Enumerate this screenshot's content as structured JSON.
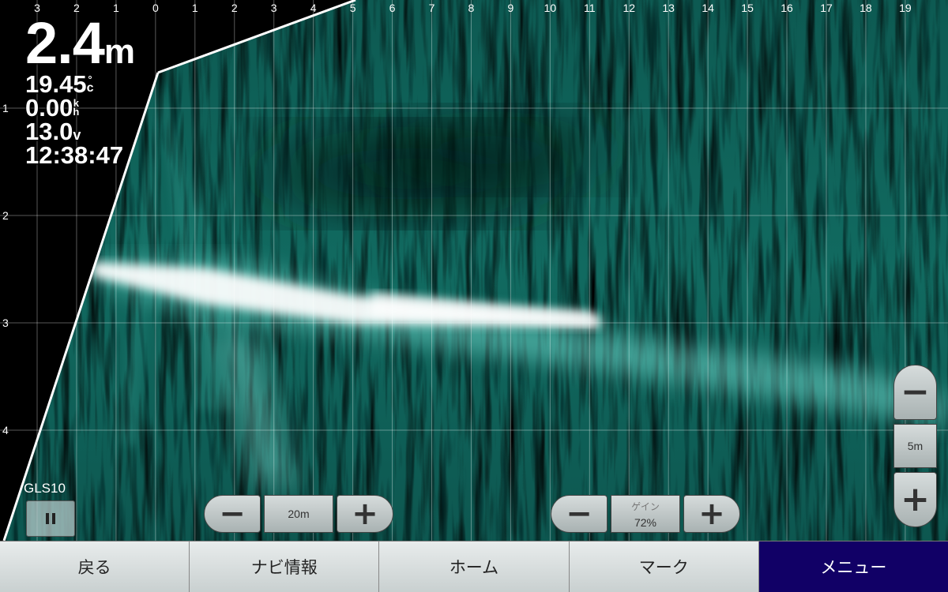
{
  "readouts": {
    "depth_value": "2.4",
    "depth_unit": "m",
    "water_temp": "19.45",
    "water_temp_unit_top": "°",
    "water_temp_unit_bottom": "c",
    "speed": "0.00",
    "speed_unit_top": "k",
    "speed_unit_bottom": "h",
    "voltage": "13.0",
    "voltage_unit": "v",
    "time": "12:38:47"
  },
  "scale": {
    "x_ticks": [
      "3",
      "2",
      "1",
      "0",
      "1",
      "2",
      "3",
      "4",
      "5",
      "6",
      "7",
      "8",
      "9",
      "10",
      "11",
      "12",
      "13",
      "14",
      "15",
      "16",
      "17",
      "18",
      "19"
    ],
    "y_ticks": [
      "1",
      "2",
      "3",
      "4"
    ]
  },
  "transducer": {
    "label": "GLS10",
    "pause_icon": "pause-icon"
  },
  "range_control": {
    "value": "20m",
    "minus_icon": "minus-icon",
    "plus_icon": "plus-icon"
  },
  "gain_control": {
    "label": "ゲイン",
    "value": "72%"
  },
  "zoom_control": {
    "value": "5m"
  },
  "colors": {
    "sonar_base": "#0b4a45",
    "sonar_accent": "#1fb8a8",
    "nav_active": "#110066"
  },
  "nav": {
    "back": "戻る",
    "navi_info": "ナビ情報",
    "home": "ホーム",
    "mark": "マーク",
    "menu": "メニュー"
  }
}
